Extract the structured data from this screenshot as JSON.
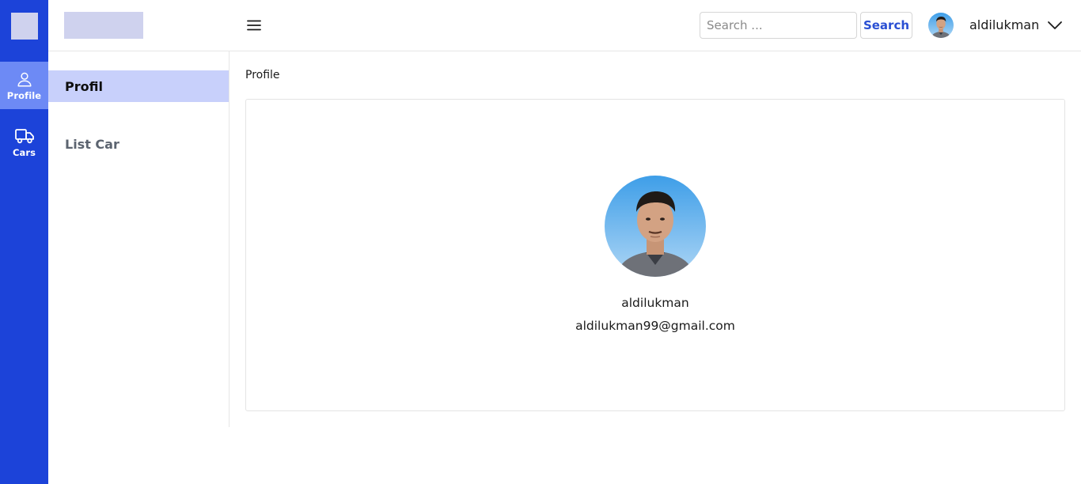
{
  "rail": {
    "items": [
      {
        "label": "Profile",
        "icon": "user-icon",
        "active": true
      },
      {
        "label": "Cars",
        "icon": "truck-icon",
        "active": false
      }
    ]
  },
  "topbar": {
    "search_placeholder": "Search ...",
    "search_button_label": "Search",
    "username": "aldilukman"
  },
  "subnav": {
    "items": [
      {
        "label": "Profil",
        "active": true
      },
      {
        "label": "List Car",
        "active": false
      }
    ]
  },
  "main": {
    "breadcrumb": "Profile",
    "profile": {
      "name": "aldilukman",
      "email": "aldilukman99@gmail.com"
    }
  },
  "colors": {
    "rail_background": "#1c43d9",
    "rail_active": "#6d8af5",
    "subnav_active": "#c8d0fb",
    "accent_text": "#2a4fd3",
    "placeholder_block": "#cfd2ee"
  }
}
